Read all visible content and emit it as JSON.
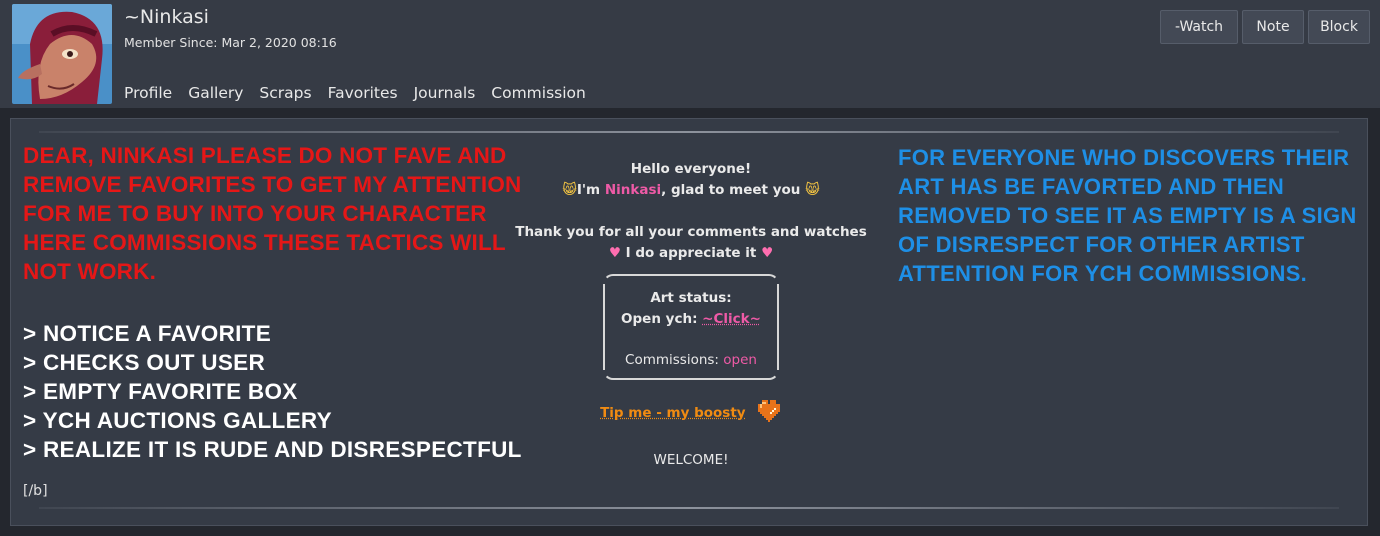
{
  "profile": {
    "username": "~Ninkasi",
    "member_since": "Member Since: Mar 2, 2020 08:16"
  },
  "nav": {
    "items": [
      "Profile",
      "Gallery",
      "Scraps",
      "Favorites",
      "Journals",
      "Commission"
    ]
  },
  "actions": {
    "watch": "-Watch",
    "note": "Note",
    "block": "Block"
  },
  "content": {
    "red_notice": "DEAR, NINKASI PLEASE DO NOT FAVE AND REMOVE FAVORITES TO GET MY ATTENTION FOR ME TO BUY INTO YOUR CHARACTER HERE COMMISSIONS THESE TACTICS WILL NOT WORK.",
    "list": [
      "> NOTICE A FAVORITE",
      "> CHECKS OUT USER",
      "> EMPTY FAVORITE BOX",
      "> YCH AUCTIONS GALLERY",
      "> REALIZE IT IS RUDE AND DISRESPECTFUL"
    ],
    "bb_close": "[/b]",
    "blue_notice": "FOR EVERYONE WHO DISCOVERS THEIR ART HAS BE FAVORTED AND THEN REMOVED TO SEE IT AS EMPTY IS A SIGN OF DISRESPECT FOR OTHER ARTIST ATTENTION FOR YCH COMMISSIONS."
  },
  "center": {
    "hello": "Hello everyone!",
    "im_prefix": "I'm ",
    "name": "Ninkasi",
    "im_suffix": ", glad to meet you",
    "thanks": "Thank you for all your comments and watches",
    "appreciate": "I do appreciate it",
    "art_status_label": "Art status:",
    "open_ych_label": "Open ych:",
    "open_ych_link": "~Click~",
    "commissions_label": "Commissions:",
    "commissions_value": "open",
    "tip_link": "Tip me - my boosty",
    "welcome": "WELCOME!"
  },
  "colors": {
    "red_notice": "#e51717",
    "blue_notice": "#1e8fe6",
    "pink_accent": "#ee5aa6",
    "orange_link": "#f08b12"
  },
  "icons": {
    "cat_face": "cat-face-icon",
    "heart": "heart-icon",
    "pixel_heart": "pixel-heart-icon"
  }
}
